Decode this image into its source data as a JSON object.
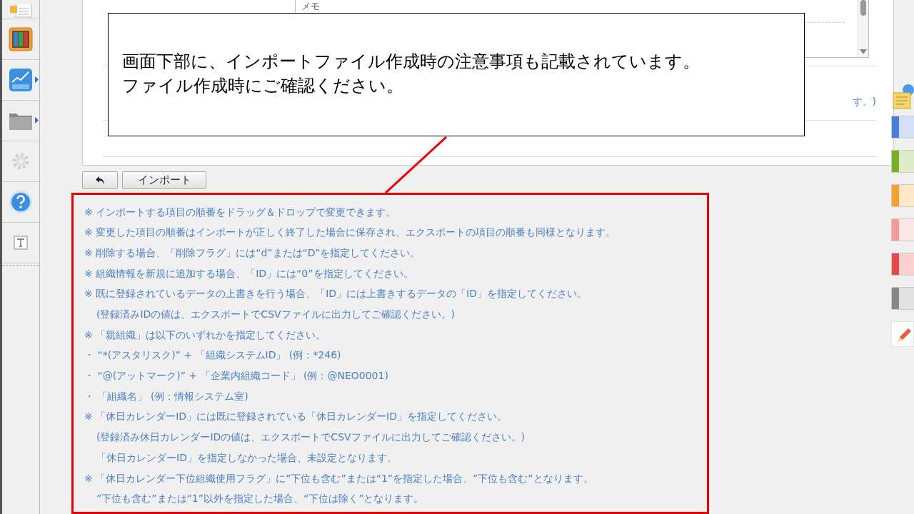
{
  "sidebar": {
    "items": [
      {
        "kind": "document",
        "submenu": false,
        "disabled": false
      },
      {
        "kind": "binders",
        "submenu": false,
        "disabled": false
      },
      {
        "kind": "chart",
        "submenu": true,
        "disabled": false
      },
      {
        "kind": "folder",
        "submenu": true,
        "disabled": false
      },
      {
        "kind": "gear",
        "submenu": false,
        "disabled": true
      },
      {
        "kind": "help",
        "submenu": false,
        "disabled": false
      },
      {
        "kind": "text",
        "submenu": false,
        "disabled": false
      }
    ]
  },
  "form": {
    "memo_label": "メモ",
    "note_fragment": "す。)"
  },
  "buttons": {
    "import": "インポート"
  },
  "notes": [
    {
      "kind": "item",
      "text": "※ インポートする項目の順番をドラッグ＆ドロップで変更できます。"
    },
    {
      "kind": "item",
      "text": "※ 変更した項目の順番はインポートが正しく終了した場合に保存され、エクスポートの項目の順番も同様となります。"
    },
    {
      "kind": "item",
      "text": "※ 削除する場合、「削除フラグ」には“d”または“D”を指定してください。"
    },
    {
      "kind": "item",
      "text": "※ 組織情報を新規に追加する場合、「ID」には“0”を指定してください。"
    },
    {
      "kind": "item",
      "text": "※ 既に登録されているデータの上書きを行う場合、「ID」には上書きするデータの「ID」を指定してください。"
    },
    {
      "kind": "continuation",
      "text": "(登録済みIDの値は、エクスポートでCSVファイルに出力してご確認ください。)"
    },
    {
      "kind": "item",
      "text": "※ 「親組織」は以下のいずれかを指定してください。"
    },
    {
      "kind": "item",
      "text": "・ “*(アスタリスク)” + 「組織システムID」 (例：*246)"
    },
    {
      "kind": "item",
      "text": "・ “@(アットマーク)” + 「企業内組織コード」 (例：@NEO0001)"
    },
    {
      "kind": "item",
      "text": "・ 「組織名」 (例：情報システム室)"
    },
    {
      "kind": "item",
      "text": "※ 「休日カレンダーID」には既に登録されている「休日カレンダーID」を指定してください。"
    },
    {
      "kind": "continuation",
      "text": "(登録済み休日カレンダーIDの値は、エクスポートでCSVファイルに出力してご確認ください。)"
    },
    {
      "kind": "continuation",
      "text": "「休日カレンダーID」を指定しなかった場合、未設定となります。"
    },
    {
      "kind": "item",
      "text": "※ 「休日カレンダー下位組織使用フラグ」に”下位も含む”または“1”を指定した場合、”下位も含む”となります。"
    },
    {
      "kind": "continuation",
      "text": "”下位も含む”または“1”以外を指定した場合、“下位は除く”となります。"
    }
  ],
  "palette": [
    {
      "color": "#4a7fdc"
    },
    {
      "color": "#7aad28"
    },
    {
      "color": "#f7a030"
    },
    {
      "color": "#f59a9a"
    },
    {
      "color": "#e84848"
    },
    {
      "color": "#888888"
    }
  ],
  "callout": {
    "lines": [
      "画面下部に、インポートファイル作成時の注意事項も記載されています。",
      "ファイル作成時にご確認ください。"
    ]
  }
}
